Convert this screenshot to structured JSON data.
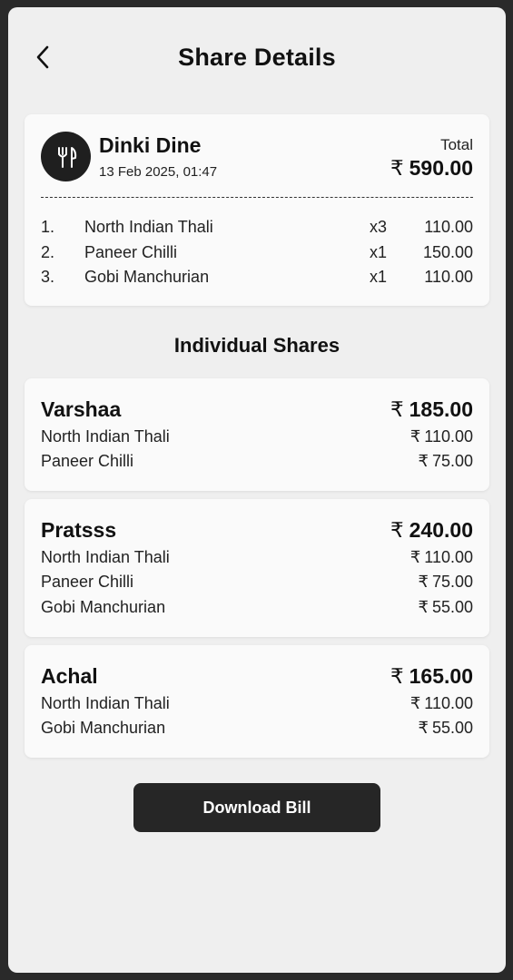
{
  "header": {
    "title": "Share Details",
    "back_icon": "chevron-left-icon"
  },
  "bill": {
    "logo_icon": "cutlery-icon",
    "restaurant": "Dinki Dine",
    "datetime": "13 Feb 2025, 01:47",
    "total_label": "Total",
    "currency": "₹",
    "total": "590.00",
    "items": [
      {
        "index": "1.",
        "name": "North Indian Thali",
        "qty": "x3",
        "price": "110.00"
      },
      {
        "index": "2.",
        "name": "Paneer Chilli",
        "qty": "x1",
        "price": "150.00"
      },
      {
        "index": "3.",
        "name": "Gobi Manchurian",
        "qty": "x1",
        "price": "110.00"
      }
    ]
  },
  "shares": {
    "title": "Individual Shares",
    "people": [
      {
        "name": "Varshaa",
        "total": "185.00",
        "items": [
          {
            "name": "North Indian Thali",
            "amount": "110.00"
          },
          {
            "name": "Paneer Chilli",
            "amount": "75.00"
          }
        ]
      },
      {
        "name": "Pratsss",
        "total": "240.00",
        "items": [
          {
            "name": "North Indian Thali",
            "amount": "110.00"
          },
          {
            "name": "Paneer Chilli",
            "amount": "75.00"
          },
          {
            "name": "Gobi Manchurian",
            "amount": "55.00"
          }
        ]
      },
      {
        "name": "Achal",
        "total": "165.00",
        "items": [
          {
            "name": "North Indian Thali",
            "amount": "110.00"
          },
          {
            "name": "Gobi Manchurian",
            "amount": "55.00"
          }
        ]
      }
    ]
  },
  "actions": {
    "download_label": "Download Bill"
  },
  "colors": {
    "background": "#efefef",
    "card": "#fafafa",
    "accent_dark": "#262626",
    "frame": "#2a2a2a"
  }
}
